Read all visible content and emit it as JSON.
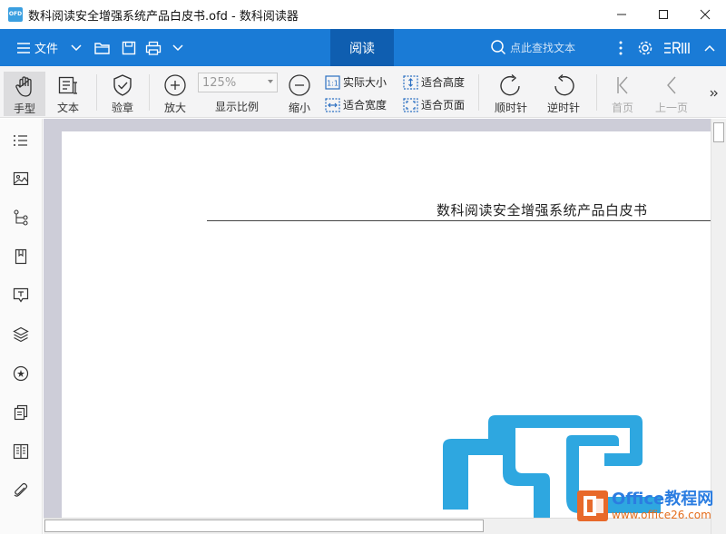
{
  "window": {
    "app_icon_text": "OFD",
    "title": "数科阅读安全增强系统产品白皮书.ofd - 数科阅读器"
  },
  "menubar": {
    "file_label": "文件",
    "reading_tab": "阅读",
    "search_placeholder": "点此查找文本"
  },
  "toolbar": {
    "hand_tool": "手型",
    "text_tool": "文本",
    "verify": "验章",
    "zoom_in": "放大",
    "zoom_value": "125%",
    "zoom_label": "显示比例",
    "zoom_out": "缩小",
    "actual_size": "实际大小",
    "fit_width": "适合宽度",
    "fit_height": "适合高度",
    "fit_page": "适合页面",
    "rotate_cw": "顺时针",
    "rotate_ccw": "逆时针",
    "first_page": "首页",
    "prev_page": "上一页"
  },
  "document": {
    "header_title": "数科阅读安全增强系统产品白皮书"
  },
  "watermark": {
    "title": "Office教程网",
    "url": "www.office26.com"
  },
  "colors": {
    "menubar": "#1a7bd6",
    "reading_tab": "#0f5eb0",
    "logo": "#2ea7e0",
    "doc_background": "#cdcdd8"
  }
}
